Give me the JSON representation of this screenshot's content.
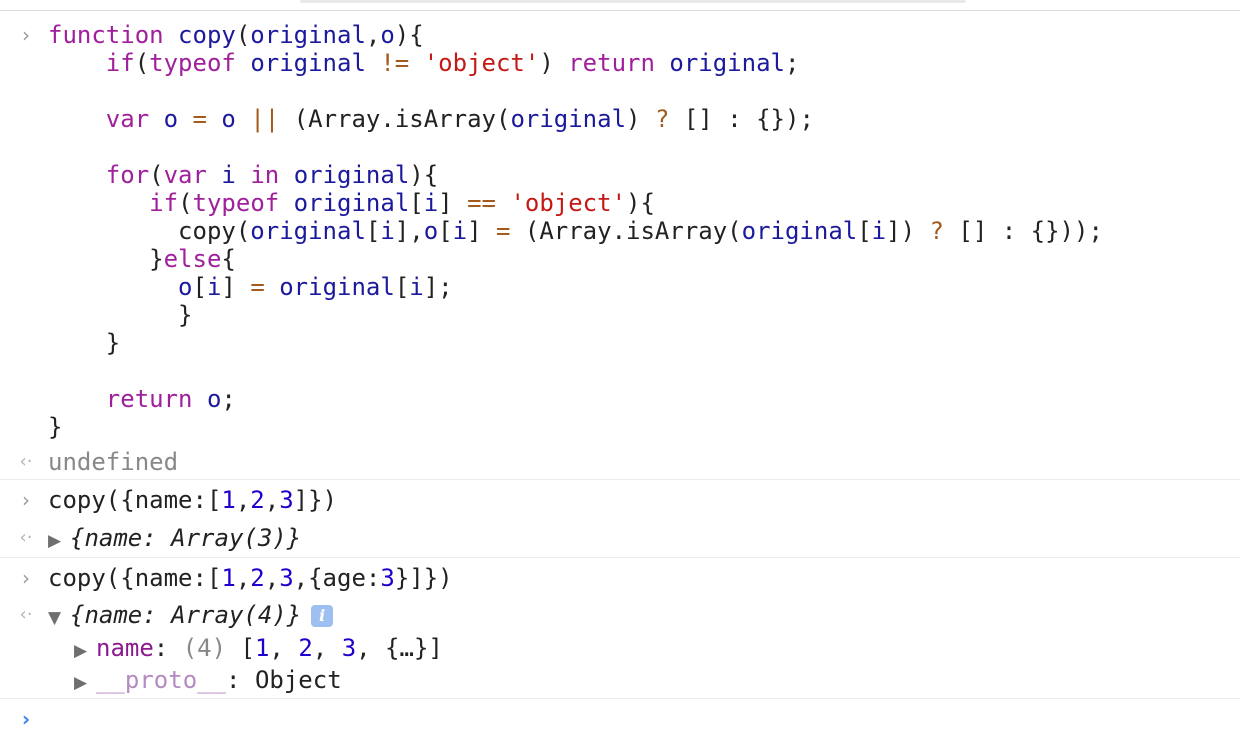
{
  "console": {
    "input_glyph": "›",
    "result_glyph": "‹·",
    "active_prompt_glyph": "›",
    "code_block": {
      "l1": {
        "kw": "function",
        "fn": "copy",
        "p1": "(",
        "a1": "original",
        "c": ",",
        "a2": "o",
        "p2": "){"
      },
      "l2": {
        "kw1": "if",
        "p1": "(",
        "kw2": "typeof",
        "id": "original",
        "op": "!=",
        "str": "'object'",
        "p2": ")",
        "kw3": "return",
        "id2": "original",
        "semi": ";"
      },
      "l4": {
        "kw": "var",
        "id1": "o",
        "op1": "=",
        "id2": "o",
        "op2": "||",
        "p1": "(Array.isArray(",
        "id3": "original",
        "p2": ")",
        "op3": "?",
        "arr": "[]",
        "colon": ":",
        "obj": "{});"
      },
      "l6": {
        "kw1": "for",
        "p1": "(",
        "kw2": "var",
        "id1": "i",
        "kw3": "in",
        "id2": "original",
        "p2": "){"
      },
      "l7": {
        "kw1": "if",
        "p1": "(",
        "kw2": "typeof",
        "id1": "original",
        "b1": "[",
        "id2": "i",
        "b2": "]",
        "op": "==",
        "str": "'object'",
        "p2": "){"
      },
      "l8": {
        "fn": "copy(",
        "id1": "original",
        "b1": "[",
        "id2": "i",
        "b2": "],",
        "id3": "o",
        "b3": "[",
        "id4": "i",
        "b4": "]",
        "op1": "=",
        "p1": "(Array.isArray(",
        "id5": "original",
        "b5": "[",
        "id6": "i",
        "b6": "])",
        "op2": "?",
        "arr": "[]",
        "colon": ":",
        "obj": "{}));"
      },
      "l9": {
        "close": "}",
        "kw": "else",
        "open": "{"
      },
      "l10": {
        "id1": "o",
        "b1": "[",
        "id2": "i",
        "b2": "]",
        "op": "=",
        "id3": "original",
        "b3": "[",
        "id4": "i",
        "b4": "];"
      },
      "l11": {
        "close": "}"
      },
      "l12": {
        "close": "}"
      },
      "l14": {
        "kw": "return",
        "id": "o",
        "semi": ";"
      },
      "l15": {
        "close": "}"
      }
    },
    "result1": "undefined",
    "cmd2": {
      "pre": "copy({name:[",
      "n1": "1",
      "c1": ",",
      "n2": "2",
      "c2": ",",
      "n3": "3",
      "post": "]})"
    },
    "result2": {
      "triangle": "▶",
      "text": "{name: Array(3)}"
    },
    "cmd3": {
      "pre": "copy({name:[",
      "n1": "1",
      "c1": ",",
      "n2": "2",
      "c2": ",",
      "n3": "3",
      "c3": ",{age:",
      "n4": "3",
      "post": "}]})"
    },
    "result3": {
      "triangle": "▼",
      "text": "{name: Array(4)}",
      "info": "i",
      "child1": {
        "triangle": "▶",
        "key": "name",
        "colon": ":",
        "count": "(4)",
        "open": "[",
        "v1": "1",
        "s1": ", ",
        "v2": "2",
        "s2": ", ",
        "v3": "3",
        "s3": ", ",
        "v4": "{…}",
        "close": "]"
      },
      "child2": {
        "triangle": "▶",
        "key": "__proto__",
        "colon": ":",
        "value": "Object"
      }
    }
  }
}
